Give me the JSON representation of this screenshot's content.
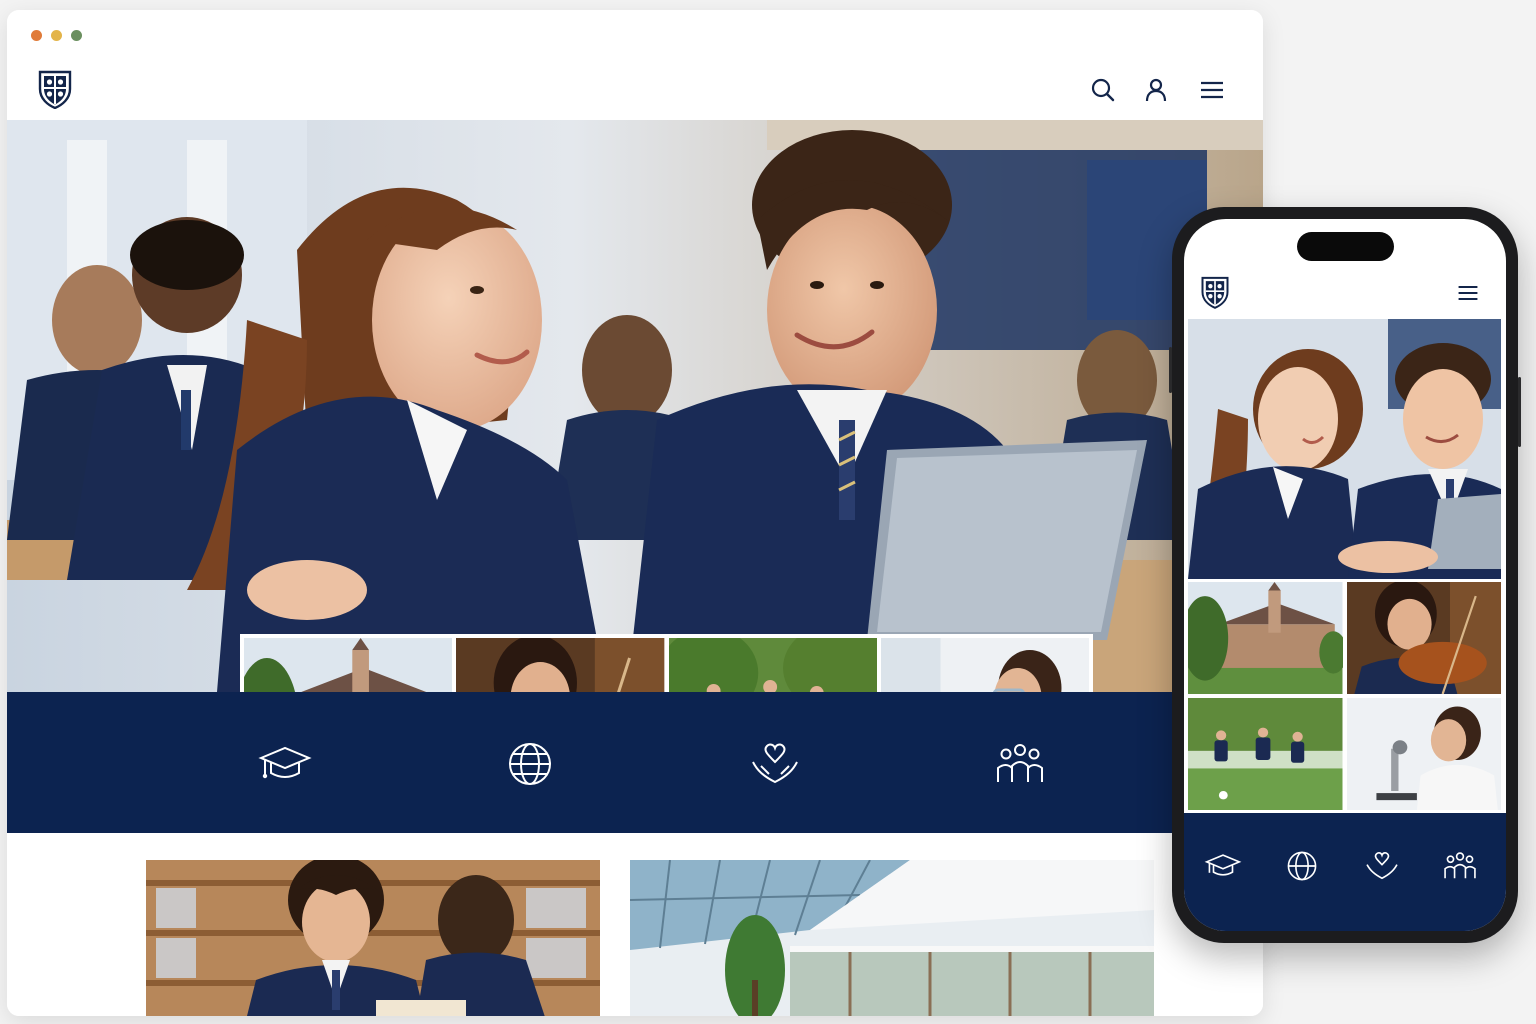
{
  "browser": {
    "window_controls": [
      "close",
      "minimize",
      "maximize"
    ],
    "control_colors": {
      "close": "#e07b39",
      "minimize": "#e3b449",
      "maximize": "#6a8f5f"
    }
  },
  "nav": {
    "logo_icon": "shield-crest-icon",
    "icons": [
      "search-icon",
      "user-account-icon",
      "hamburger-menu-icon"
    ]
  },
  "hero": {
    "image": "students-smiling-at-laptop",
    "thumbnails": [
      {
        "name": "campus-building",
        "icon": "photo"
      },
      {
        "name": "student-violin",
        "icon": "photo"
      },
      {
        "name": "students-soccer",
        "icon": "photo"
      },
      {
        "name": "student-microscope",
        "icon": "photo"
      }
    ]
  },
  "values": {
    "icons": [
      "graduation-cap-icon",
      "globe-icon",
      "hands-heart-icon",
      "community-people-icon"
    ]
  },
  "lower_images": [
    "student-reading-library",
    "glass-atrium"
  ],
  "mobile": {
    "logo_icon": "shield-crest-icon",
    "menu_icon": "hamburger-menu-icon",
    "hero_image": "students-smiling-at-laptop",
    "thumbnails": [
      "campus-building",
      "student-violin",
      "students-soccer",
      "student-microscope"
    ],
    "value_icons": [
      "graduation-cap-icon",
      "globe-icon",
      "hands-heart-icon",
      "community-people-icon"
    ]
  },
  "colors": {
    "brand_navy": "#0c2350",
    "background": "#f3f3f3",
    "surface": "#ffffff",
    "icon_dark": "#13254a"
  }
}
